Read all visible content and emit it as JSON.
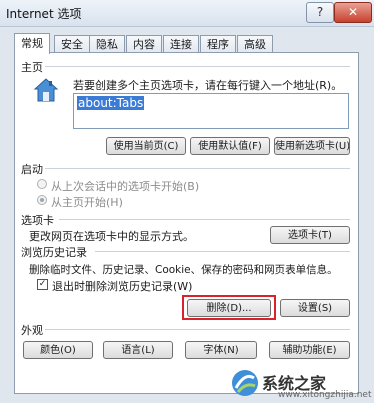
{
  "window": {
    "title": "Internet 选项",
    "help_label": "?",
    "close_label": "✕"
  },
  "tabs": [
    "常规",
    "安全",
    "隐私",
    "内容",
    "连接",
    "程序",
    "高级"
  ],
  "homepage": {
    "section_label": "主页",
    "instruction": "若要创建多个主页选项卡，请在每行键入一个地址(R)。",
    "address_value": "about:Tabs",
    "buttons": {
      "use_current": "使用当前页(C)",
      "use_default": "使用默认值(F)",
      "use_new_tab": "使用新选项卡(U)"
    }
  },
  "startup": {
    "section_label": "启动",
    "option_last_session": "从上次会话中的选项卡开始(B)",
    "option_homepage": "从主页开始(H)"
  },
  "tabs_section": {
    "section_label": "选项卡",
    "description": "更改网页在选项卡中的显示方式。",
    "button": "选项卡(T)"
  },
  "history": {
    "section_label": "浏览历史记录",
    "description": "删除临时文件、历史记录、Cookie、保存的密码和网页表单信息。",
    "checkbox_label": "退出时删除浏览历史记录(W)",
    "checkbox_checked": true,
    "delete_button": "删除(D)...",
    "settings_button": "设置(S)"
  },
  "appearance": {
    "section_label": "外观",
    "colors_button": "颜色(O)",
    "languages_button": "语言(L)",
    "fonts_button": "字体(N)",
    "accessibility_button": "辅助功能(E)"
  },
  "watermark": {
    "text": "系统之家",
    "url": "www.xitongzhijia.net"
  }
}
